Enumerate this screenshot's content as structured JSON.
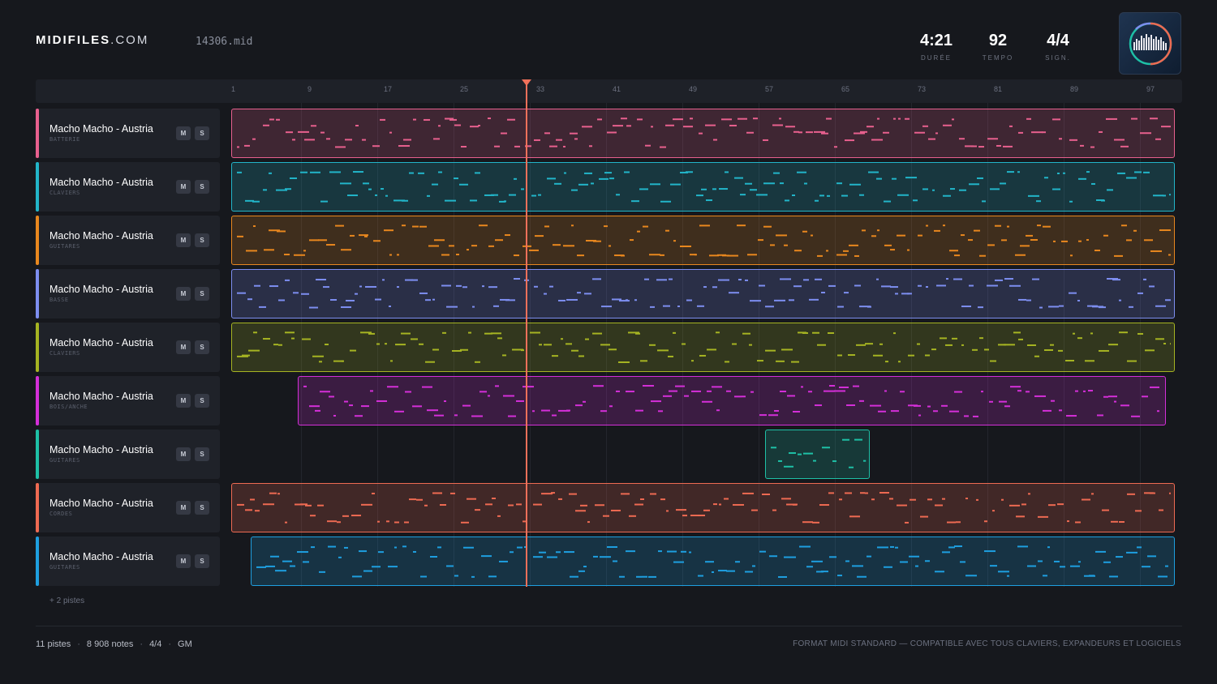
{
  "brand": {
    "name_bold": "MIDIFILES",
    "name_light": ".COM"
  },
  "file": {
    "name": "14306.mid"
  },
  "stats": [
    {
      "value": "4:21",
      "label": "DURÉE"
    },
    {
      "value": "92",
      "label": "TEMPO"
    },
    {
      "value": "4/4",
      "label": "SIGN."
    }
  ],
  "ruler": {
    "ticks": [
      "1",
      "9",
      "17",
      "25",
      "33",
      "41",
      "49",
      "57",
      "65",
      "73",
      "81",
      "89",
      "97"
    ],
    "playhead_bar": 32
  },
  "tracks": [
    {
      "name": "Macho Macho - Austria",
      "category": "BATTERIE",
      "color": "#e8608e",
      "mute": "M",
      "solo": "S"
    },
    {
      "name": "Macho Macho - Austria",
      "category": "CLAVIERS",
      "color": "#22b5c9",
      "mute": "M",
      "solo": "S"
    },
    {
      "name": "Macho Macho - Austria",
      "category": "GUITARES",
      "color": "#e8871e",
      "mute": "M",
      "solo": "S"
    },
    {
      "name": "Macho Macho - Austria",
      "category": "BASSE",
      "color": "#7d8ef0",
      "mute": "M",
      "solo": "S"
    },
    {
      "name": "Macho Macho - Austria",
      "category": "CLAVIERS",
      "color": "#a6b422",
      "mute": "M",
      "solo": "S"
    },
    {
      "name": "Macho Macho - Austria",
      "category": "BOIS/ANCHE",
      "color": "#d42fd8",
      "mute": "M",
      "solo": "S"
    },
    {
      "name": "Macho Macho - Austria",
      "category": "GUITARES",
      "color": "#1ec0a6",
      "mute": "M",
      "solo": "S"
    },
    {
      "name": "Macho Macho - Austria",
      "category": "CORDES",
      "color": "#ee6a52",
      "mute": "M",
      "solo": "S"
    },
    {
      "name": "Macho Macho - Austria",
      "category": "GUITARES",
      "color": "#1e9fe0",
      "mute": "M",
      "solo": "S"
    }
  ],
  "more_tracks": "+ 2 pistes",
  "footer": {
    "tracks": "11 pistes",
    "notes": "8 908 notes",
    "signature": "4/4",
    "standard": "GM",
    "format_note": "FORMAT MIDI STANDARD — COMPATIBLE AVEC TOUS CLAVIERS, EXPANDEURS ET LOGICIELS"
  }
}
